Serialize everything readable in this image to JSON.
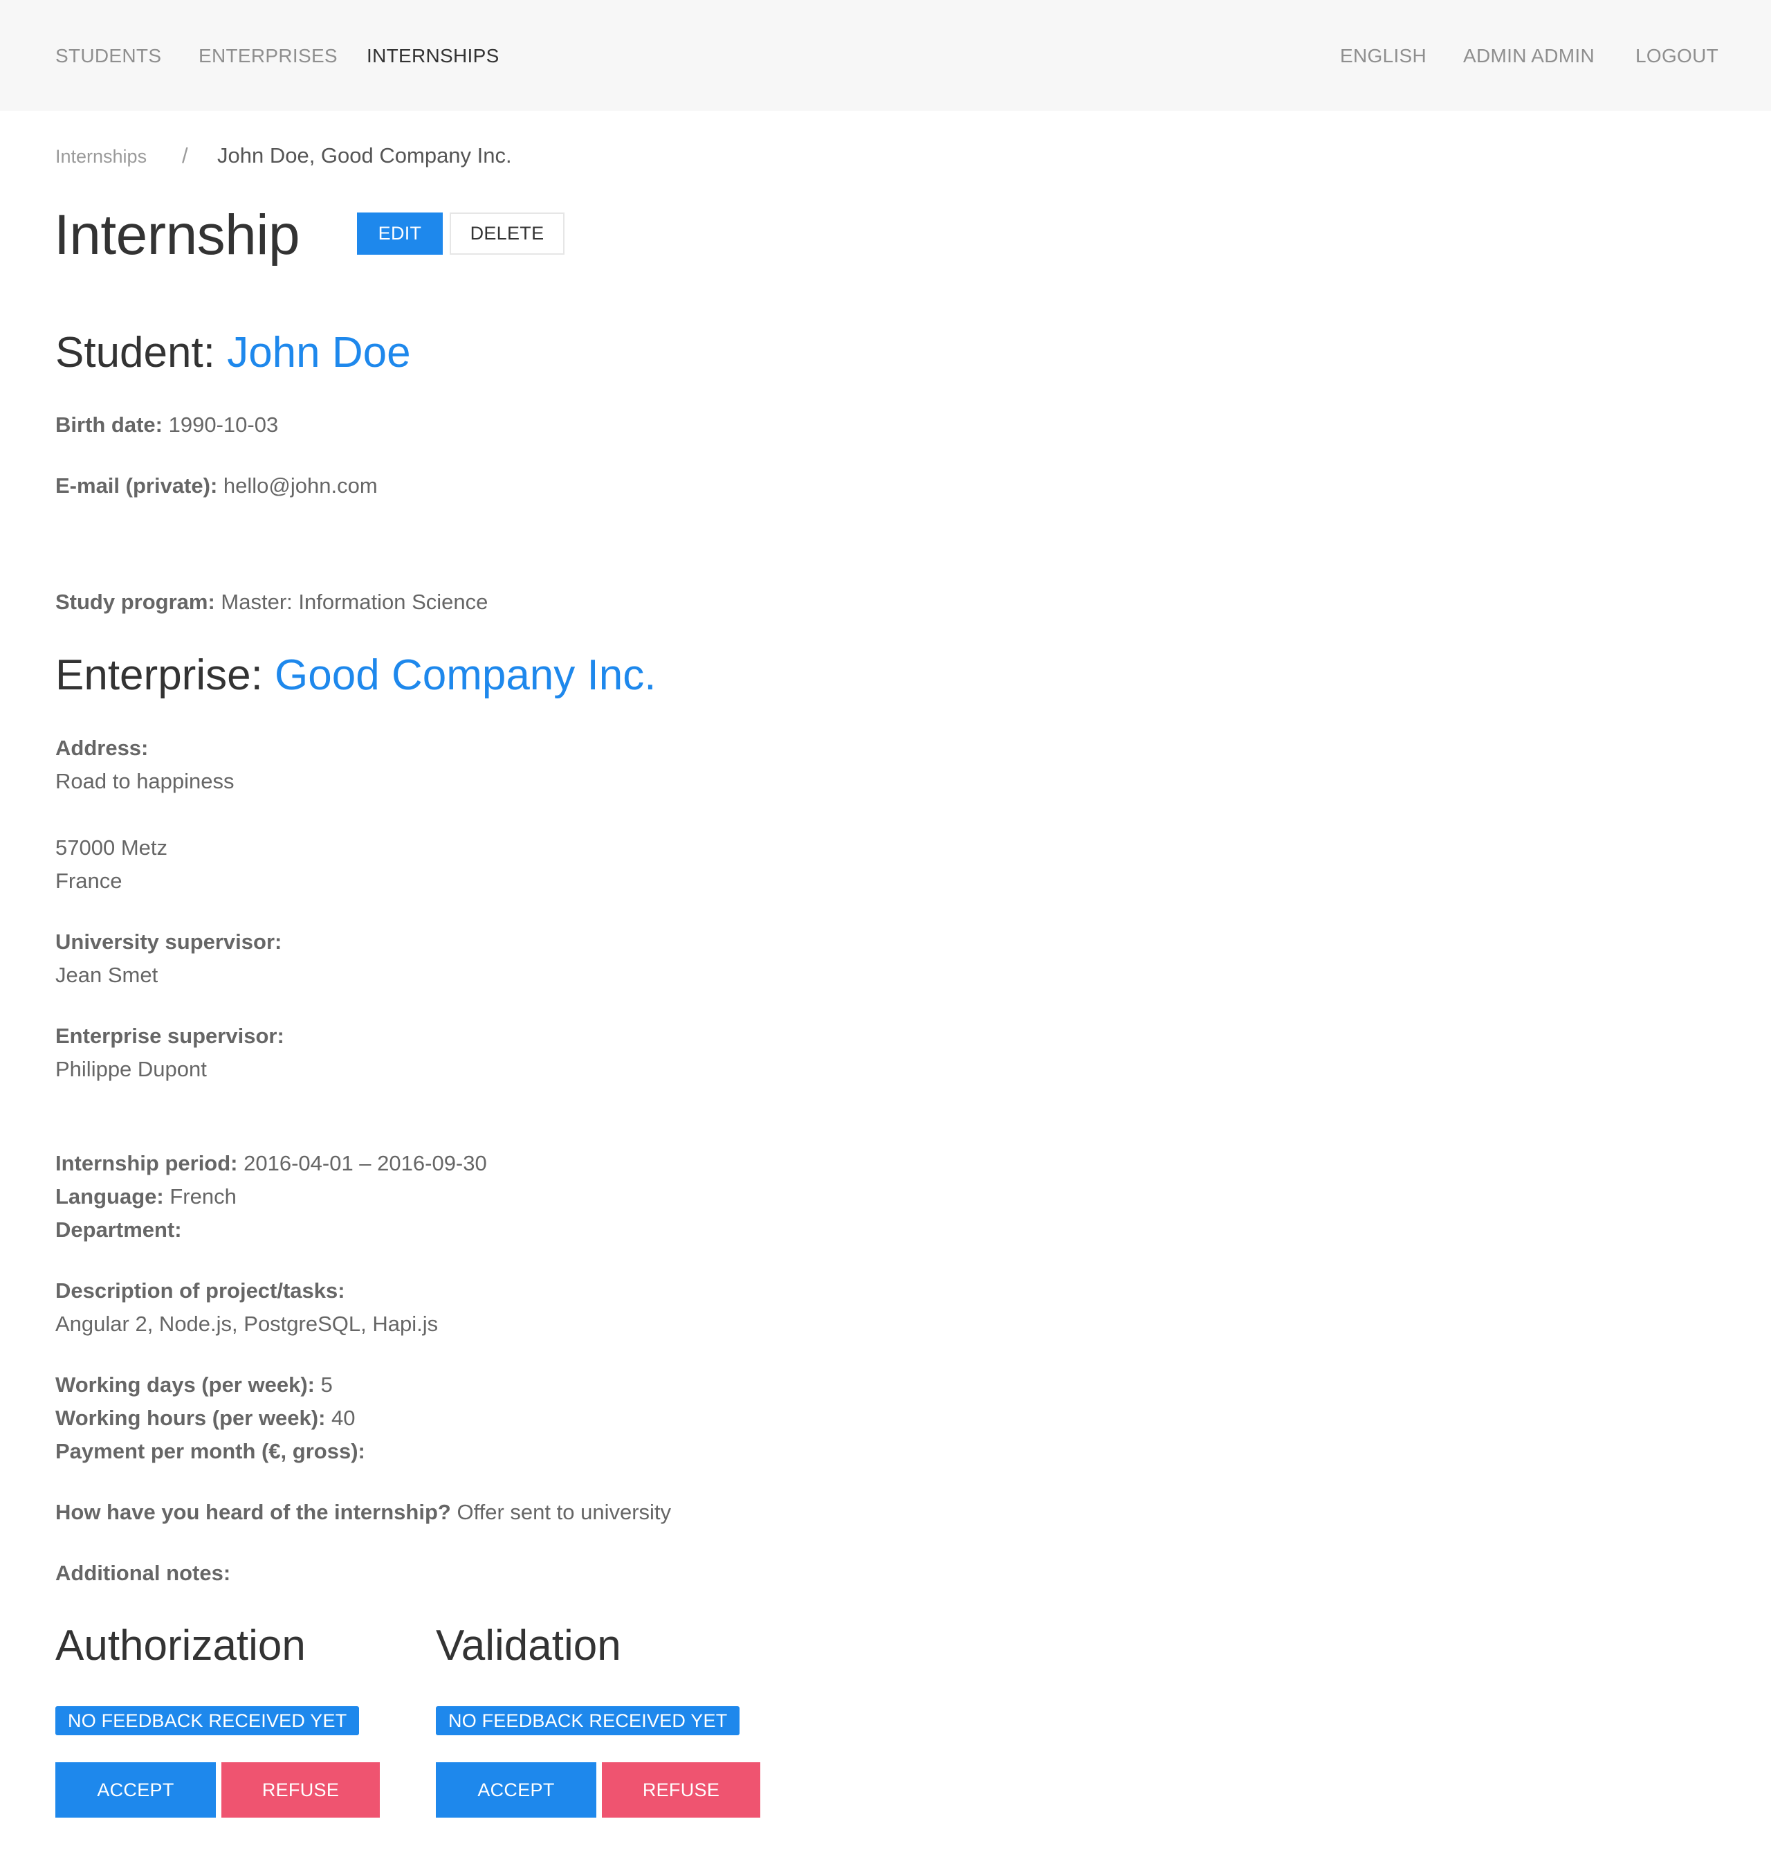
{
  "navbar": {
    "left_items": [
      {
        "label": "STUDENTS",
        "active": false
      },
      {
        "label": "ENTERPRISES",
        "active": false
      },
      {
        "label": "INTERNSHIPS",
        "active": true
      }
    ],
    "right_items": [
      {
        "label": "ENGLISH"
      },
      {
        "label": "ADMIN ADMIN"
      },
      {
        "label": "LOGOUT"
      }
    ]
  },
  "breadcrumb": {
    "parent": "Internships",
    "separator": "/",
    "current": "John Doe, Good Company Inc."
  },
  "page": {
    "title": "Internship",
    "edit_label": "EDIT",
    "delete_label": "DELETE"
  },
  "student": {
    "heading_label": "Student:",
    "name": "John Doe",
    "birth_date_label": "Birth date:",
    "birth_date": "1990-10-03",
    "email_label": "E-mail (private):",
    "email": "hello@john.com",
    "study_program_label": "Study program:",
    "study_program": "Master: Information Science"
  },
  "enterprise": {
    "heading_label": "Enterprise:",
    "name": "Good Company Inc.",
    "address_label": "Address:",
    "address_line1": "Road to happiness",
    "address_line2": "57000 Metz",
    "address_line3": "France",
    "university_supervisor_label": "University supervisor:",
    "university_supervisor": "Jean Smet",
    "enterprise_supervisor_label": "Enterprise supervisor:",
    "enterprise_supervisor": "Philippe Dupont"
  },
  "internship": {
    "period_label": "Internship period:",
    "period": "2016-04-01 – 2016-09-30",
    "language_label": "Language:",
    "language": "French",
    "department_label": "Department:",
    "department": "",
    "description_label": "Description of project/tasks:",
    "description": "Angular 2, Node.js, PostgreSQL, Hapi.js",
    "working_days_label": "Working days (per week):",
    "working_days": "5",
    "working_hours_label": "Working hours (per week):",
    "working_hours": "40",
    "payment_label": "Payment per month (€, gross):",
    "payment": "",
    "heard_label": "How have you heard of the internship?",
    "heard": "Offer sent to university",
    "notes_label": "Additional notes:",
    "notes": ""
  },
  "authorization": {
    "title": "Authorization",
    "status": "NO FEEDBACK RECEIVED YET",
    "accept_label": "ACCEPT",
    "refuse_label": "REFUSE"
  },
  "validation": {
    "title": "Validation",
    "status": "NO FEEDBACK RECEIVED YET",
    "accept_label": "ACCEPT",
    "refuse_label": "REFUSE"
  },
  "colors": {
    "primary": "#1e88ec",
    "danger": "#ef5470",
    "navbar_bg": "#f7f7f7"
  }
}
